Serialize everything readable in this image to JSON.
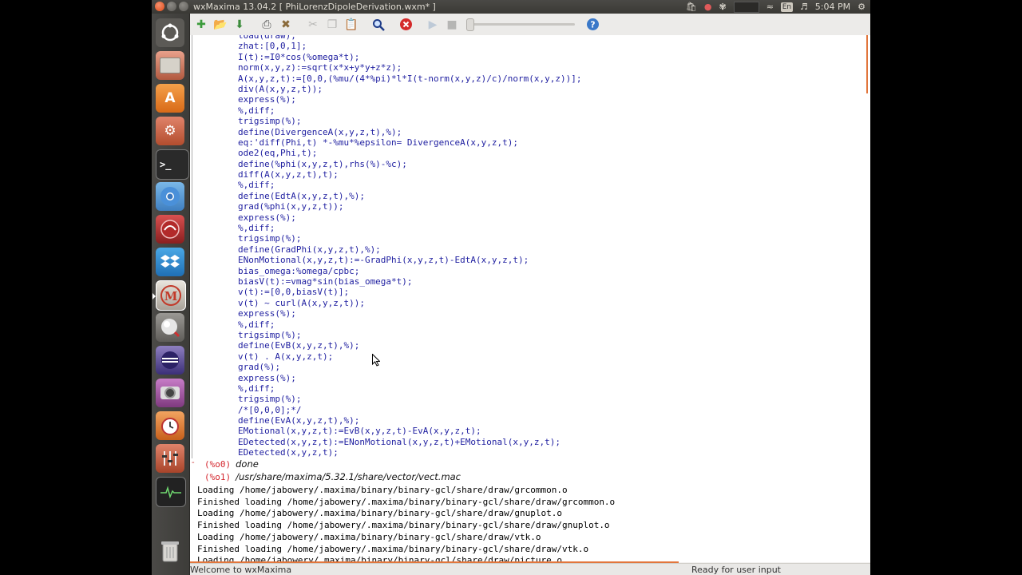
{
  "window": {
    "title": "wxMaxima 13.04.2  [ PhiLorenzDipoleDerivation.wxm* ]"
  },
  "panel": {
    "keyboard_layout": "En",
    "clock": "5:04 PM"
  },
  "launcher": {
    "items": [
      {
        "name": "dash-home-icon"
      },
      {
        "name": "files-icon"
      },
      {
        "name": "software-center-icon"
      },
      {
        "name": "system-settings-icon"
      },
      {
        "name": "terminal-icon"
      },
      {
        "name": "chromium-icon"
      },
      {
        "name": "app-icon-red"
      },
      {
        "name": "dropbox-icon"
      },
      {
        "name": "wxmaxima-icon",
        "label": "M"
      },
      {
        "name": "app-icon-sphere"
      },
      {
        "name": "eclipse-icon"
      },
      {
        "name": "webcam-icon"
      },
      {
        "name": "alarm-clock-icon"
      },
      {
        "name": "mixer-icon"
      },
      {
        "name": "system-monitor-icon"
      },
      {
        "name": "trash-icon"
      }
    ]
  },
  "toolbar": {
    "buttons": [
      "new-document-icon",
      "open-icon",
      "save-icon",
      "print-icon",
      "config-icon",
      "cut-icon",
      "copy-icon",
      "paste-icon",
      "find-icon",
      "interrupt-icon",
      "play-icon",
      "stop-icon",
      "help-icon"
    ]
  },
  "code_lines": [
    "load(draw);",
    "zhat:[0,0,1];",
    "I(t):=I0*cos(%omega*t);",
    "norm(x,y,z):=sqrt(x*x+y*y+z*z);",
    "A(x,y,z,t):=[0,0,(%mu/(4*%pi)*l*I(t-norm(x,y,z)/c)/norm(x,y,z))];",
    "div(A(x,y,z,t));",
    "express(%);",
    "%,diff;",
    "trigsimp(%);",
    "define(DivergenceA(x,y,z,t),%);",
    "eq:'diff(Phi,t) *-%mu*%epsilon= DivergenceA(x,y,z,t);",
    "ode2(eq,Phi,t);",
    "define(%phi(x,y,z,t),rhs(%)-%c);",
    "diff(A(x,y,z,t),t);",
    "%,diff;",
    "define(EdtA(x,y,z,t),%);",
    "grad(%phi(x,y,z,t));",
    "express(%);",
    "%,diff;",
    "trigsimp(%);",
    "define(GradPhi(x,y,z,t),%);",
    "ENonMotional(x,y,z,t):=-GradPhi(x,y,z,t)-EdtA(x,y,z,t);",
    "bias_omega:%omega/cpbc;",
    "biasV(t):=vmag*sin(bias_omega*t);",
    "v(t):=[0,0,biasV(t)];",
    "v(t) ~ curl(A(x,y,z,t));",
    "express(%);",
    "%,diff;",
    "trigsimp(%);",
    "define(EvB(x,y,z,t),%);",
    "v(t) . A(x,y,z,t);",
    "grad(%);",
    "express(%);",
    "%,diff;",
    "trigsimp(%);",
    "/*[0,0,0];*/",
    "define(EvA(x,y,z,t),%);",
    "EMotional(x,y,z,t):=EvB(x,y,z,t)-EvA(x,y,z,t);",
    "EDetected(x,y,z,t):=ENonMotional(x,y,z,t)+EMotional(x,y,z,t);",
    "EDetected(x,y,z,t);"
  ],
  "outputs": [
    {
      "label": "(%o0)",
      "value": "done"
    },
    {
      "label": "(%o1)",
      "value": "/usr/share/maxima/5.32.1/share/vector/vect.mac"
    }
  ],
  "load_messages": [
    "Loading /home/jabowery/.maxima/binary/binary-gcl/share/draw/grcommon.o",
    "Finished loading /home/jabowery/.maxima/binary/binary-gcl/share/draw/grcommon.o",
    "Loading /home/jabowery/.maxima/binary/binary-gcl/share/draw/gnuplot.o",
    "Finished loading /home/jabowery/.maxima/binary/binary-gcl/share/draw/gnuplot.o",
    "Loading /home/jabowery/.maxima/binary/binary-gcl/share/draw/vtk.o",
    "Finished loading /home/jabowery/.maxima/binary/binary-gcl/share/draw/vtk.o",
    "Loading /home/jabowery/.maxima/binary/binary-gcl/share/draw/picture.o"
  ],
  "statusbar": {
    "left": "Welcome to wxMaxima",
    "right": "Ready for user input"
  }
}
